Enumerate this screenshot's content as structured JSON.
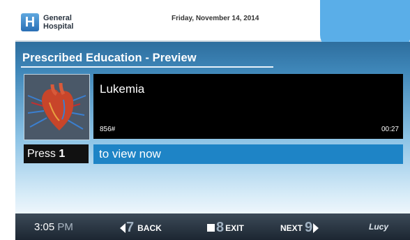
{
  "header": {
    "logo_letter": "H",
    "hospital_name_line1": "General",
    "hospital_name_line2": "Hospital",
    "date": "Friday, November 14, 2014"
  },
  "section": {
    "title": "Prescribed Education - Preview"
  },
  "video": {
    "title": "Lukemia",
    "code": "856#",
    "duration": "00:27",
    "thumbnail_icon": "heart-anatomy-icon"
  },
  "prompt": {
    "press_label": "Press",
    "press_key": "1",
    "action_text": "to view now"
  },
  "footer": {
    "time": "3:05",
    "ampm": "PM",
    "back_key": "7",
    "back_label": "BACK",
    "exit_key": "8",
    "exit_label": "EXIT",
    "next_label": "NEXT",
    "next_key": "9",
    "brand": "Lucy"
  },
  "colors": {
    "header_blob": "#5aaee8",
    "action_bar": "#1e84c6",
    "footer_bg": "#1c2632"
  }
}
